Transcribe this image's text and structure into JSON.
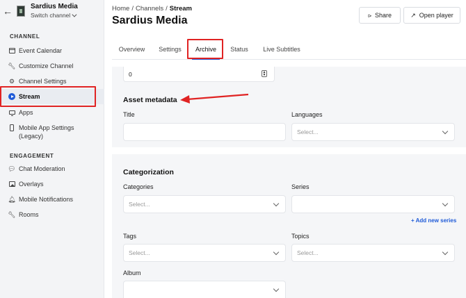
{
  "sidebar": {
    "channel_name": "Sardius Media",
    "switch_label": "Switch channel",
    "section_channel": "CHANNEL",
    "section_engagement": "ENGAGEMENT",
    "items": [
      {
        "label": "Event Calendar",
        "icon": "calendar-icon"
      },
      {
        "label": "Customize Channel",
        "icon": "wrench-icon"
      },
      {
        "label": "Channel Settings",
        "icon": "gear-icon"
      },
      {
        "label": "Stream",
        "icon": "play-circle-icon",
        "active": true
      },
      {
        "label": "Apps",
        "icon": "monitor-icon"
      },
      {
        "label": "Mobile App Settings",
        "label2": "(Legacy)",
        "icon": "phone-icon"
      },
      {
        "label": "Chat Moderation",
        "icon": "chat-bubbles-icon"
      },
      {
        "label": "Overlays",
        "icon": "image-icon"
      },
      {
        "label": "Mobile Notifications",
        "icon": "bell-icon"
      },
      {
        "label": "Rooms",
        "icon": "wrench-icon"
      }
    ]
  },
  "header": {
    "breadcrumb": [
      "Home",
      "Channels",
      "Stream"
    ],
    "title": "Sardius Media",
    "share_label": "Share",
    "open_player_label": "Open player"
  },
  "tabs": [
    "Overview",
    "Settings",
    "Archive",
    "Status",
    "Live Subtitles"
  ],
  "active_tab": "Archive",
  "form": {
    "number_value": "0",
    "asset_metadata_heading": "Asset metadata",
    "title_label": "Title",
    "title_value": "",
    "languages_label": "Languages",
    "languages_placeholder": "Select...",
    "categorization_heading": "Categorization",
    "categories_label": "Categories",
    "categories_placeholder": "Select...",
    "series_label": "Series",
    "series_placeholder": "",
    "add_series_label": "+ Add new series",
    "tags_label": "Tags",
    "tags_placeholder": "Select...",
    "topics_label": "Topics",
    "topics_placeholder": "Select...",
    "album_label": "Album",
    "album_placeholder": ""
  },
  "colors": {
    "accent": "#1f5bd8",
    "highlight_red": "#e02323",
    "sidebar_bg": "#f3f4f6"
  }
}
